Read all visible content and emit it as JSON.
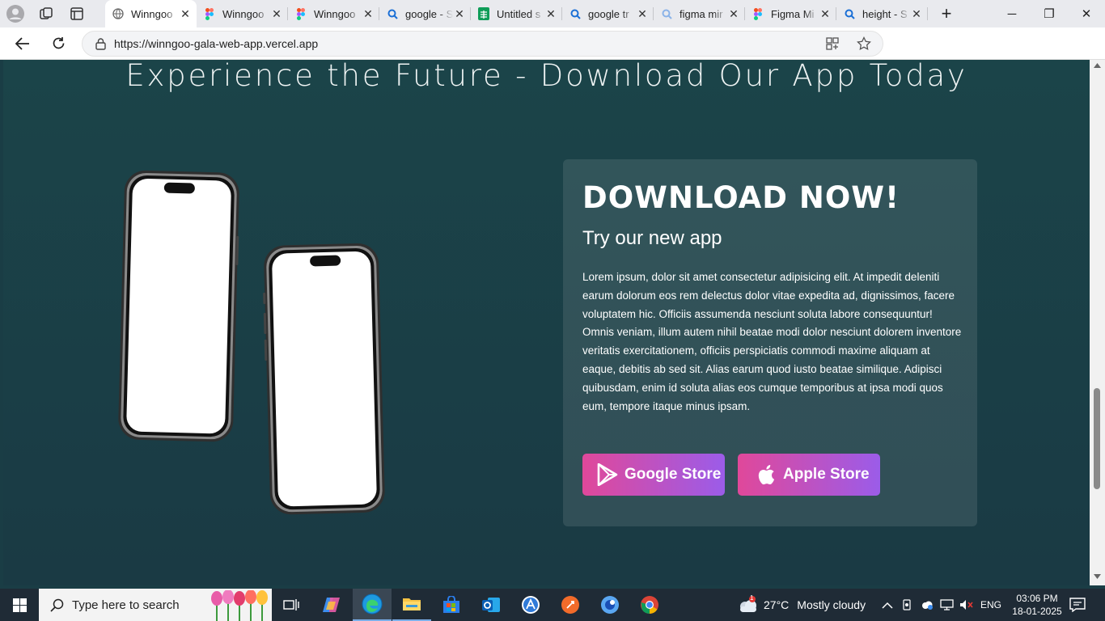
{
  "browser": {
    "tabs": [
      {
        "label": "Winngoo",
        "icon": "globe-icon",
        "active": true
      },
      {
        "label": "Winngoo",
        "icon": "figma-icon"
      },
      {
        "label": "Winngoo",
        "icon": "figma-icon"
      },
      {
        "label": "google - S",
        "icon": "search-icon"
      },
      {
        "label": "Untitled s",
        "icon": "sheets-icon"
      },
      {
        "label": "google tr",
        "icon": "search-icon"
      },
      {
        "label": "figma mir",
        "icon": "search-icon"
      },
      {
        "label": "Figma Mi",
        "icon": "figma-icon"
      },
      {
        "label": "height - S",
        "icon": "search-icon"
      }
    ],
    "url": "https://winngoo-gala-web-app.vercel.app"
  },
  "page": {
    "heading": "Experience the Future - Download Our App Today",
    "card": {
      "title": "DOWNLOAD NOW!",
      "subtitle": "Try our new app",
      "body": "Lorem ipsum, dolor sit amet consectetur adipisicing elit. At impedit deleniti earum dolorum eos rem delectus dolor vitae expedita ad, dignissimos, facere voluptatem hic. Officiis assumenda nesciunt soluta labore consequuntur! Omnis veniam, illum autem nihil beatae modi dolor nesciunt dolorem inventore veritatis exercitationem, officiis perspiciatis commodi maxime aliquam at eaque, debitis ab sed sit. Alias earum quod iusto beatae similique. Adipisci quibusdam, enim id soluta alias eos cumque temporibus at ipsa modi quos eum, tempore itaque minus ipsam.",
      "google_label": "Google Store",
      "apple_label": "Apple Store"
    },
    "colors": {
      "background": "#1b4449",
      "button_start": "#e0489a",
      "button_end": "#9b5ce9"
    }
  },
  "taskbar": {
    "search_placeholder": "Type here to search",
    "weather_temp": "27°C",
    "weather_text": "Mostly cloudy",
    "weather_badge": "1",
    "language": "ENG",
    "time": "03:06 PM",
    "date": "18-01-2025"
  }
}
